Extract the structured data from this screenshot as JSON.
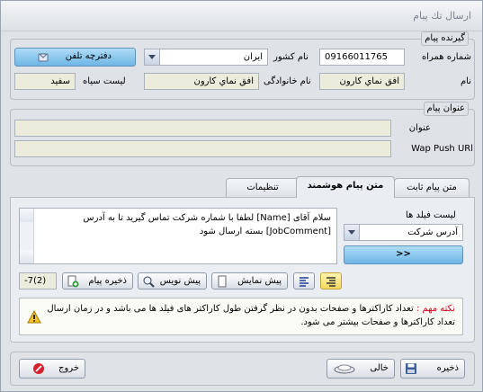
{
  "window": {
    "title": "ارسال تك پيام"
  },
  "recipient": {
    "group_title": "گیرنده پیام",
    "phone_label": "شماره همراه",
    "phone_value": "09166011765",
    "country_label": "نام کشور",
    "country_value": "ايران",
    "phonebook_button": "دفترچه تلفن",
    "name_label": "نام",
    "name_value": "افق نماي كارون",
    "family_label": "نام خانوادگی",
    "family_value": "افق نماي كارون",
    "blacklist_label": "لیست سیاه",
    "blacklist_value": "سفيد"
  },
  "subject": {
    "group_title": "عنوان پیام",
    "title_label": "عنوان",
    "title_value": "",
    "wap_label": "Wap Push URl",
    "wap_value": ""
  },
  "tabs": [
    {
      "label": "متن پیام ثابت"
    },
    {
      "label": "متن پیام هوشمند"
    },
    {
      "label": "تنظیمات"
    }
  ],
  "smart": {
    "field_list_label": "لیست فیلد ها",
    "field_select_value": "آدرس شركت",
    "insert_button": ">>",
    "message_text": "سلام آقای [Name] لطفا با شماره شرکت تماس گیرید تا به آدرس [JobComment] بسته ارسال شود",
    "save_message_button": "ذخیره پیام",
    "draft_button": "پیش نویس",
    "preview_button": "پیش نمایش",
    "counter": "-7(2)",
    "note_title": "نکته مهم :",
    "note_text": "تعداد کاراکترها و صفحات بدون در نظر گرفتن طول کاراکتر های فیلد ها می باشد و در زمان ارسال تعداد کاراکترها و صفحات بیشتر می شود."
  },
  "footer": {
    "save_button": "ذخیره",
    "clear_button": "خالی",
    "exit_button": "خروج"
  },
  "colors": {
    "accent_blue": "#8cc8ee",
    "warning_red": "#d0021b",
    "window_bg": "#dfe3e8"
  }
}
